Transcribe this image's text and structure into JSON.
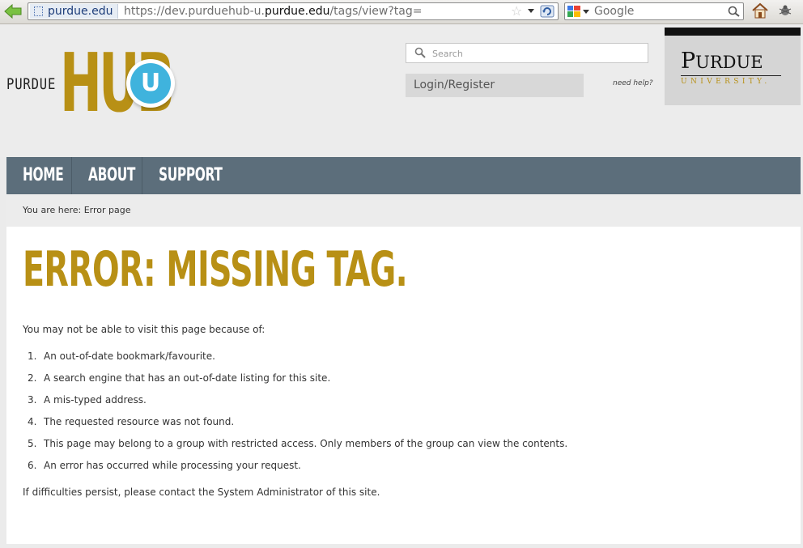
{
  "browser": {
    "site_identity": "purdue.edu",
    "url_prefix": "https://dev.purduehub-u.",
    "url_domain": "purdue.edu",
    "url_suffix": "/tags/view?tag=",
    "search_engine": "Google"
  },
  "header": {
    "logo_purdue": "PURDUE",
    "logo_hub": "HUB",
    "logo_u": "U",
    "search_placeholder": "Search",
    "login_label": "Login/Register",
    "need_help": "need help?",
    "university_name_cap": "P",
    "university_name_rest": "URDUE",
    "university_sub": "UNIVERSITY."
  },
  "nav": {
    "items": [
      {
        "label": "HOME"
      },
      {
        "label": "ABOUT"
      },
      {
        "label": "SUPPORT"
      }
    ]
  },
  "breadcrumb": "You are here: Error page",
  "main": {
    "title": "ERROR: MISSING TAG.",
    "intro": "You may not be able to visit this page because of:",
    "reasons": [
      "An out-of-date bookmark/favourite.",
      "A search engine that has an out-of-date listing for this site.",
      "A mis-typed address.",
      "The requested resource was not found.",
      "This page may belong to a group with restricted access. Only members of the group can view the contents.",
      "An error has occurred while processing your request."
    ],
    "outro": "If difficulties persist, please contact the System Administrator of this site."
  },
  "colors": {
    "gold": "#b89015",
    "nav": "#5c6e7b",
    "accent_blue": "#3fb3dd"
  }
}
